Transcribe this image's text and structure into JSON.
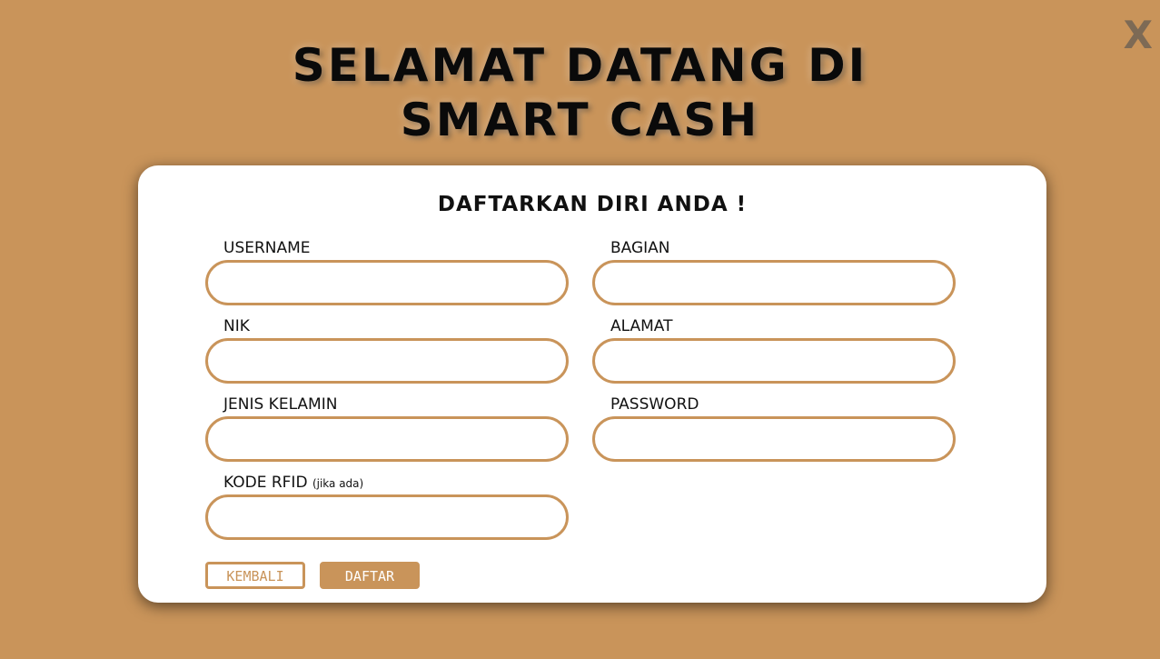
{
  "close_label": "X",
  "title": {
    "line1": "SELAMAT DATANG DI",
    "line2": "SMART CASH"
  },
  "form": {
    "heading": "DAFTARKAN DIRI ANDA !",
    "fields": {
      "username": {
        "label": "USERNAME",
        "value": ""
      },
      "bagian": {
        "label": "BAGIAN",
        "value": ""
      },
      "nik": {
        "label": "NIK",
        "value": ""
      },
      "alamat": {
        "label": "ALAMAT",
        "value": ""
      },
      "jenis_kelamin": {
        "label": "JENIS KELAMIN",
        "value": ""
      },
      "password": {
        "label": "PASSWORD",
        "value": ""
      },
      "rfid": {
        "label": "KODE RFID",
        "note": "(jika ada)",
        "value": ""
      }
    },
    "buttons": {
      "back": "KEMBALI",
      "submit": "DAFTAR"
    }
  },
  "colors": {
    "background": "#c9945a",
    "card": "#ffffff",
    "accent": "#c9945a",
    "close": "#7d6a55"
  }
}
